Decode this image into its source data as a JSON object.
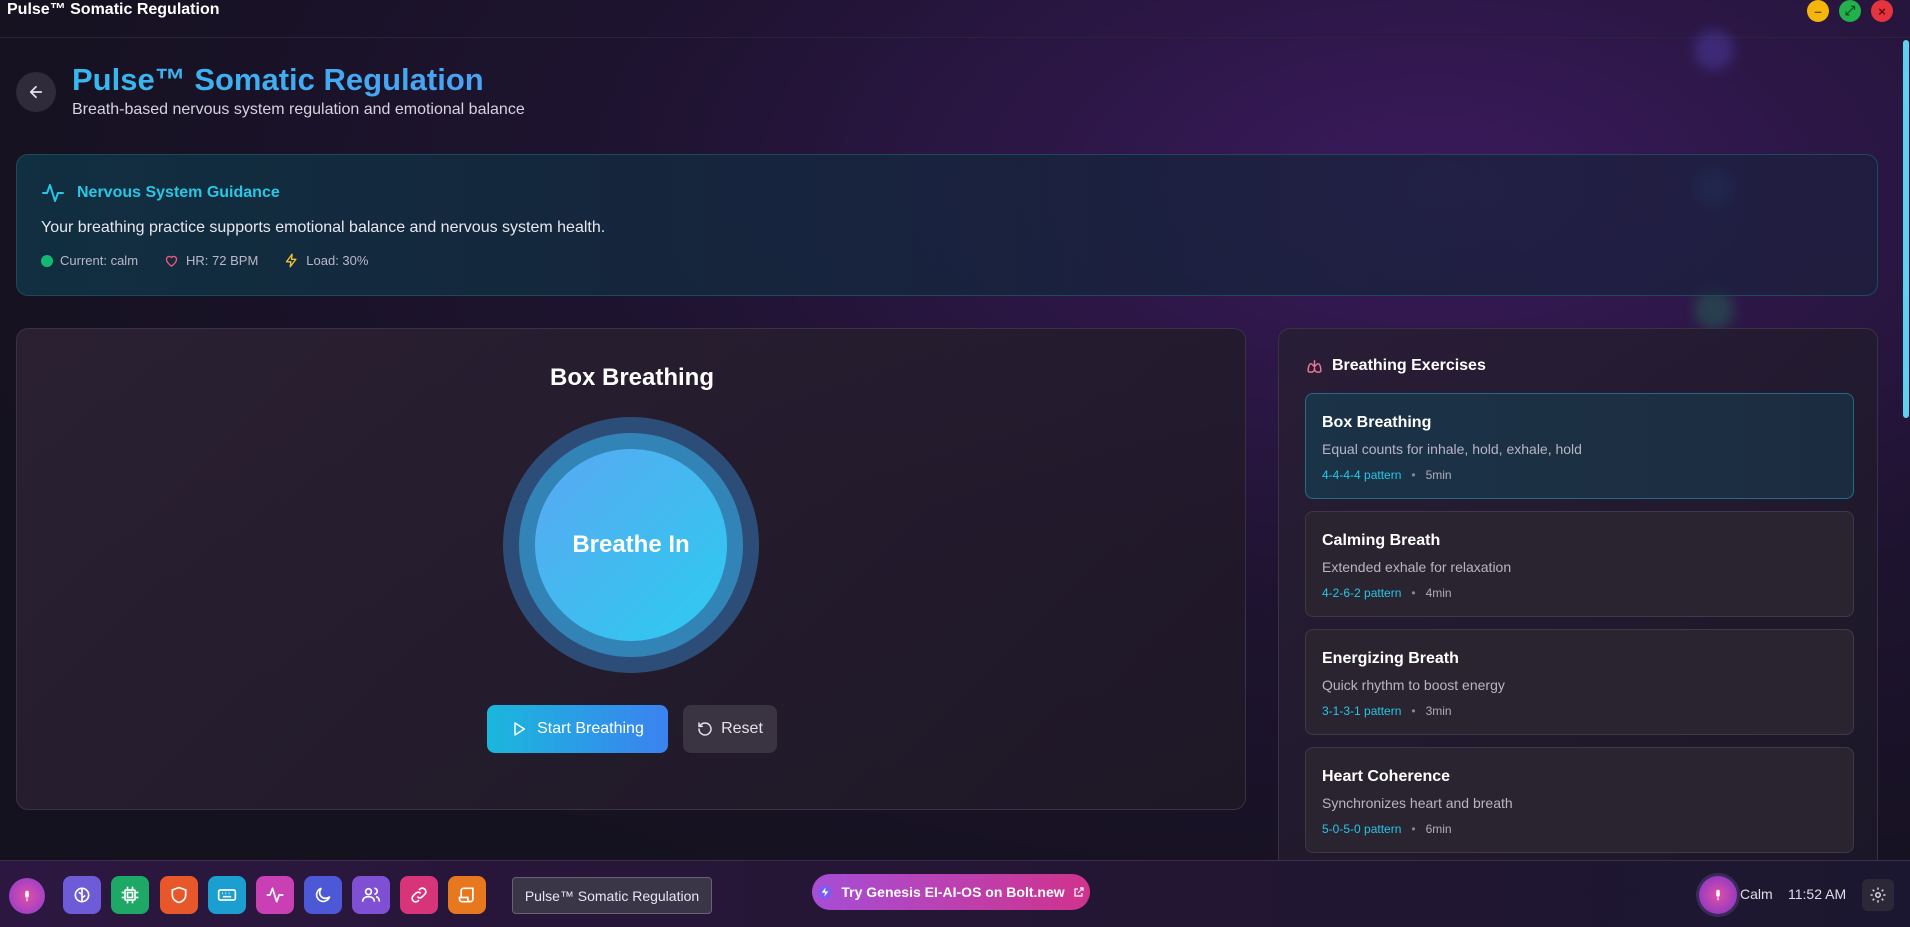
{
  "window": {
    "title": "Pulse™ Somatic Regulation",
    "controls": {
      "minimize": "–",
      "maximize": "⤢",
      "close": "×"
    }
  },
  "header": {
    "title": "Pulse™ Somatic Regulation",
    "subtitle": "Breath-based nervous system regulation and emotional balance",
    "back_icon": "arrow-left-icon"
  },
  "guidance": {
    "title": "Nervous System Guidance",
    "icon": "activity-icon",
    "message": "Your breathing practice supports emotional balance and nervous system health.",
    "stats": {
      "state": "Current: calm",
      "heart_rate": "HR: 72 BPM",
      "load": "Load: 30%"
    }
  },
  "breathing": {
    "exercise_title": "Box Breathing",
    "phase_label": "Breathe In",
    "start_label": "Start Breathing",
    "reset_label": "Reset"
  },
  "exercises": {
    "title": "Breathing Exercises",
    "icon": "lungs-icon",
    "items": [
      {
        "name": "Box Breathing",
        "description": "Equal counts for inhale, hold, exhale, hold",
        "pattern": "4-4-4-4 pattern",
        "separator": "•",
        "duration": "5min",
        "active": true
      },
      {
        "name": "Calming Breath",
        "description": "Extended exhale for relaxation",
        "pattern": "4-2-6-2 pattern",
        "separator": "•",
        "duration": "4min",
        "active": false
      },
      {
        "name": "Energizing Breath",
        "description": "Quick rhythm to boost energy",
        "pattern": "3-1-3-1 pattern",
        "separator": "•",
        "duration": "3min",
        "active": false
      },
      {
        "name": "Heart Coherence",
        "description": "Synchronizes heart and breath",
        "pattern": "5-0-5-0 pattern",
        "separator": "•",
        "duration": "6min",
        "active": false
      }
    ]
  },
  "taskbar": {
    "active_task": "Pulse™ Somatic Regulation",
    "promo_label": "Try Genesis EI-AI-OS on Bolt.new",
    "status": "Calm",
    "time": "11:52 AM",
    "apps": [
      {
        "name": "brain-icon",
        "color": "#6d5bd8"
      },
      {
        "name": "cpu-icon",
        "color": "#1ea866"
      },
      {
        "name": "shield-icon",
        "color": "#e8572a"
      },
      {
        "name": "keyboard-icon",
        "color": "#1a9fd0"
      },
      {
        "name": "pulse-icon",
        "color": "#c940b4"
      },
      {
        "name": "moon-icon",
        "color": "#4c58d6"
      },
      {
        "name": "users-icon",
        "color": "#8050d4"
      },
      {
        "name": "link-icon",
        "color": "#d8347a"
      },
      {
        "name": "scroll-icon",
        "color": "#e8781e"
      }
    ]
  },
  "colors": {
    "accent_cyan": "#27c7e6",
    "accent_blue": "#3b82f0",
    "calm_green": "#14b870",
    "heart_red": "#f0567a",
    "load_yellow": "#f2c230"
  }
}
